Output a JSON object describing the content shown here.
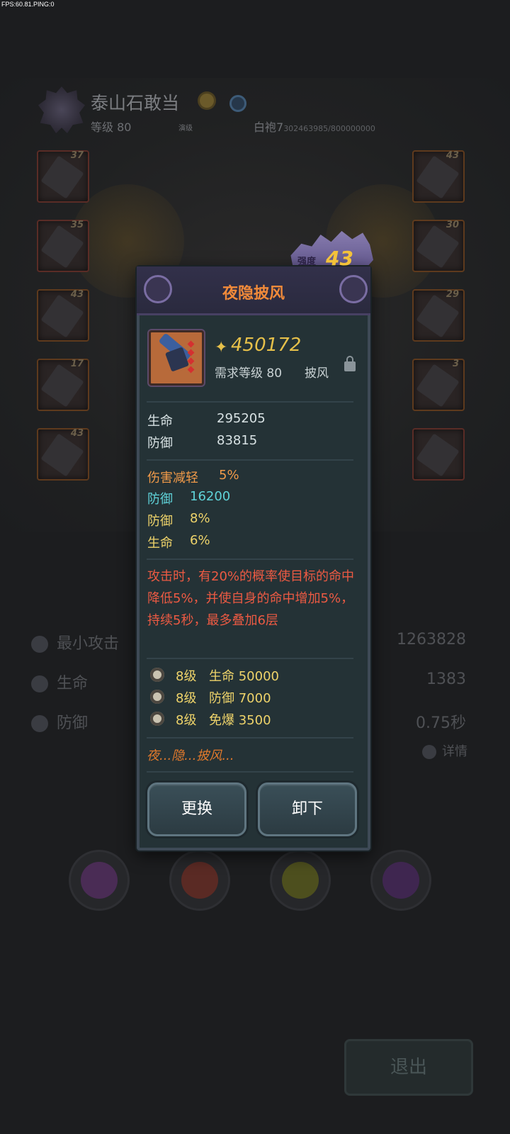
{
  "hud": {
    "fps": "FPS:60.81.PING:0"
  },
  "character": {
    "name": "泰山石敢当",
    "level": "等级 80",
    "rank_label": "演级",
    "exp_label": "白袍7",
    "exp_value": "302463985/800000000"
  },
  "slots": {
    "left": [
      "37",
      "35",
      "43",
      "17",
      "43"
    ],
    "right": [
      "43",
      "30",
      "29",
      "3",
      ""
    ]
  },
  "stats": [
    {
      "label": "最小攻击",
      "value": "1263828"
    },
    {
      "label": "生命",
      "value": "1383"
    },
    {
      "label": "防御",
      "value": "0.75秒"
    }
  ],
  "detail_label": "详情",
  "exit_label": "退出",
  "item": {
    "title": "夜隐披风",
    "strength_label": "强度",
    "strength": "43",
    "power": "450172",
    "required_level": "需求等级 80",
    "type": "披风",
    "base_attrs": [
      {
        "name": "生命",
        "value": "295205"
      },
      {
        "name": "防御",
        "value": "83815"
      }
    ],
    "extra_attrs": [
      {
        "name": "伤害减轻",
        "value": "5%"
      },
      {
        "name": "防御",
        "value": "16200"
      },
      {
        "name": "防御",
        "value": "8%"
      },
      {
        "name": "生命",
        "value": "6%"
      }
    ],
    "skill": "攻击时，有20%的概率使目标的命中降低5%，并使自身的命中增加5%，持续5秒，最多叠加6层",
    "set_bonuses": [
      {
        "level": "8级",
        "attr": "生命 50000"
      },
      {
        "level": "8级",
        "attr": "防御 7000"
      },
      {
        "level": "8级",
        "attr": "免爆 3500"
      }
    ],
    "flavor": "夜...隐...披风...",
    "buttons": {
      "replace": "更换",
      "unequip": "卸下"
    }
  }
}
